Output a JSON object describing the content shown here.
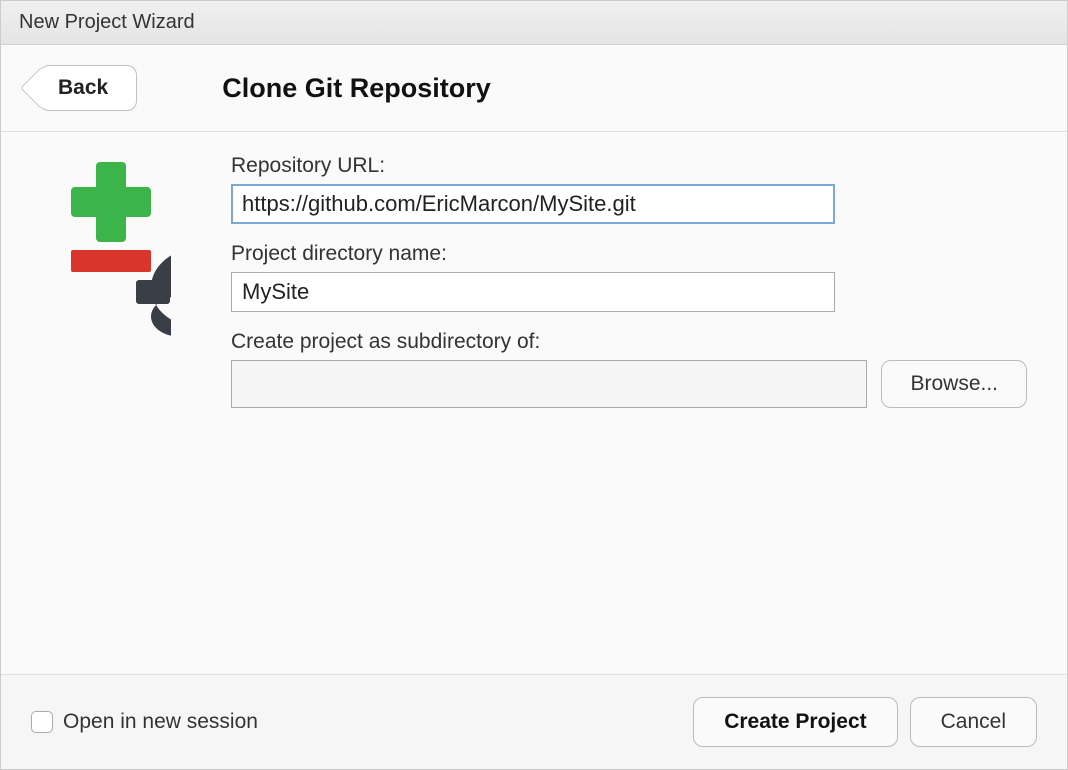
{
  "window": {
    "title": "New Project Wizard"
  },
  "header": {
    "back_label": "Back",
    "page_title": "Clone Git Repository"
  },
  "form": {
    "repo_url_label": "Repository URL:",
    "repo_url_value": "https://github.com/EricMarcon/MySite.git",
    "project_dir_label": "Project directory name:",
    "project_dir_value": "MySite",
    "subdir_label": "Create project as subdirectory of:",
    "subdir_value": "",
    "browse_label": "Browse..."
  },
  "footer": {
    "open_new_session_label": "Open in new session",
    "create_project_label": "Create Project",
    "cancel_label": "Cancel"
  }
}
